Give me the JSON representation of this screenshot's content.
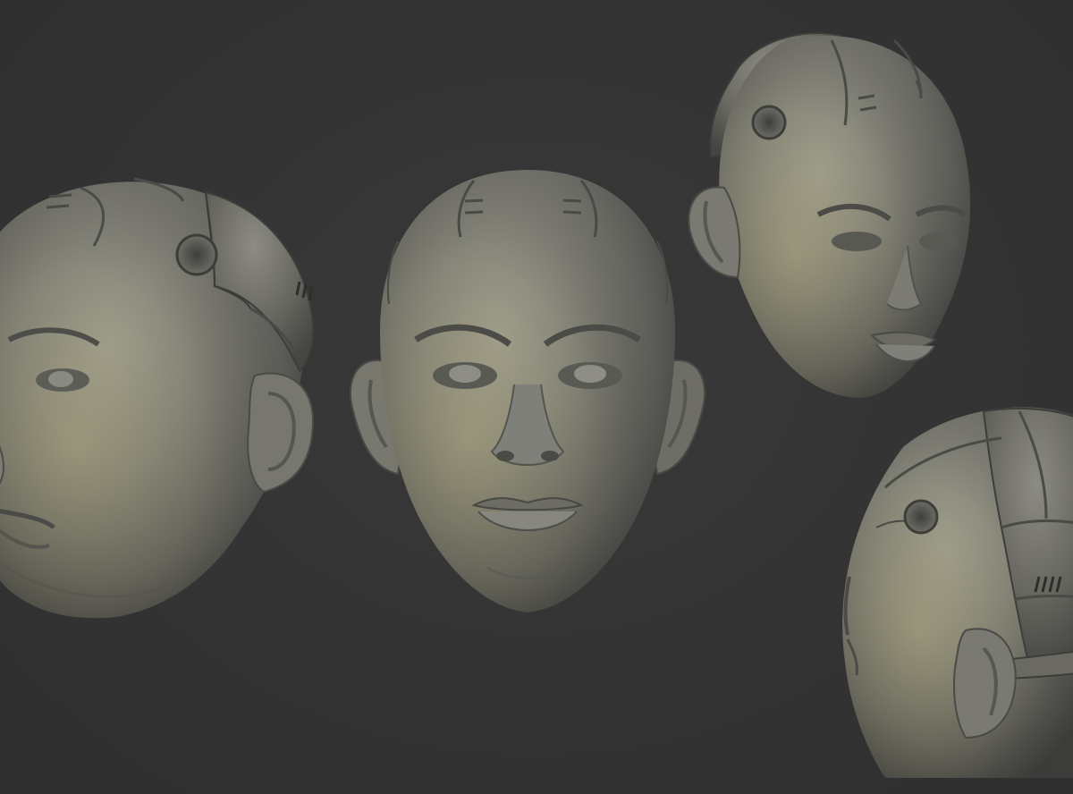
{
  "scene": {
    "background_color": "#343434",
    "material_color": "#7a7a72",
    "highlight_color": "#b9b98a",
    "shadow_color": "#3a3a38"
  },
  "renders": [
    {
      "view": "three-quarter-left",
      "icon": "sculpted-head"
    },
    {
      "view": "front",
      "icon": "sculpted-head"
    },
    {
      "view": "three-quarter-right",
      "icon": "sculpted-head"
    },
    {
      "view": "back-three-quarter",
      "icon": "sculpted-head"
    }
  ]
}
